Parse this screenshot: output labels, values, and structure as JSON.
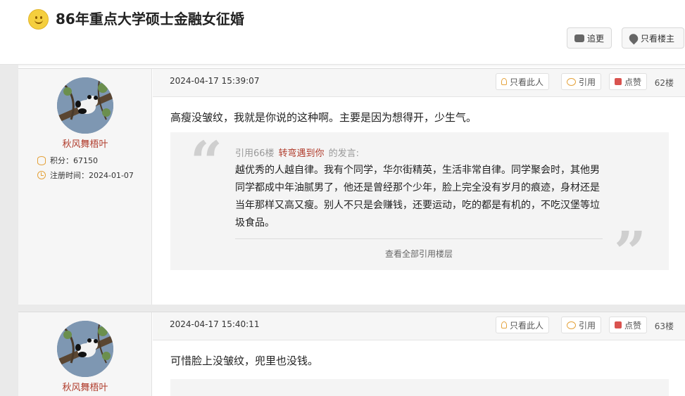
{
  "thread": {
    "title": "86年重点大学硕士金融女征婚",
    "chase_label": "追更",
    "only_owner_label": "只看楼主"
  },
  "posts": [
    {
      "author": {
        "name": "秋风舞梧叶",
        "points": "积分：67150",
        "registered": "注册时间：2024-01-07"
      },
      "time": "2024-04-17 15:39:07",
      "only_this_label": "只看此人",
      "quote_label": "引用",
      "like_label": "点赞",
      "floor": "62楼",
      "text": "高瘦没皱纹，我就是你说的这种啊。主要是因为想得开，少生气。",
      "quote": {
        "prefix": "引用66楼",
        "author": "转弯遇到你",
        "suffix": "的发言:",
        "text": "越优秀的人越自律。我有个同学，华尔街精英，生活非常自律。同学聚会时，其他男同学都成中年油腻男了，他还是曾经那个少年，脸上完全没有岁月的痕迹，身材还是当年那样又高又瘦。别人不只是会赚钱，还要运动，吃的都是有机的，不吃汉堡等垃圾食品。",
        "view_all": "查看全部引用楼层"
      }
    },
    {
      "author": {
        "name": "秋风舞梧叶"
      },
      "time": "2024-04-17 15:40:11",
      "only_this_label": "只看此人",
      "quote_label": "引用",
      "like_label": "点赞",
      "floor": "63楼",
      "text": "可惜脸上没皱纹，兜里也没钱。"
    }
  ]
}
